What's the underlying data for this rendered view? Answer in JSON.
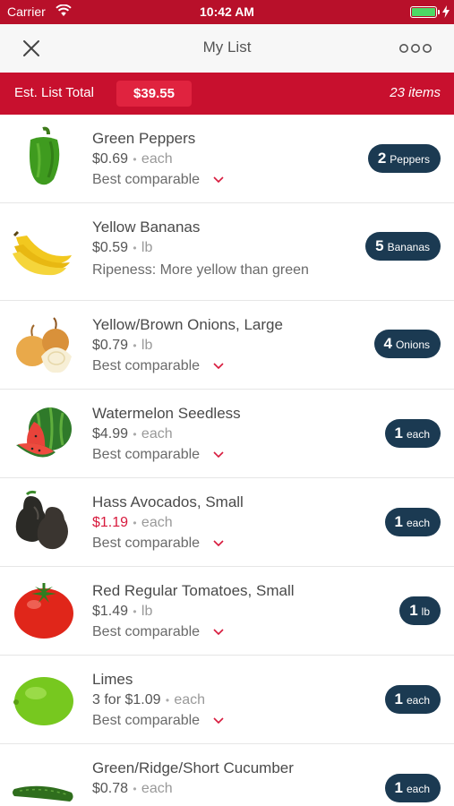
{
  "status_bar": {
    "carrier": "Carrier",
    "time": "10:42 AM",
    "battery_level": 1.0
  },
  "nav": {
    "title": "My List"
  },
  "summary": {
    "label": "Est. List Total",
    "total": "$39.55",
    "count": "23 items"
  },
  "items": [
    {
      "name": "Green Peppers",
      "price": "$0.69",
      "unit": "each",
      "sub": "Best comparable",
      "has_chevron": true,
      "qty": "2",
      "qty_unit": "Peppers",
      "sale": false
    },
    {
      "name": "Yellow Bananas",
      "price": "$0.59",
      "unit": "lb",
      "sub": "Ripeness: More yellow than green",
      "has_chevron": false,
      "qty": "5",
      "qty_unit": "Bananas",
      "sale": false
    },
    {
      "name": "Yellow/Brown Onions, Large",
      "price": "$0.79",
      "unit": "lb",
      "sub": "Best comparable",
      "has_chevron": true,
      "qty": "4",
      "qty_unit": "Onions",
      "sale": false
    },
    {
      "name": "Watermelon   Seedless",
      "price": "$4.99",
      "unit": "each",
      "sub": "Best comparable",
      "has_chevron": true,
      "qty": "1",
      "qty_unit": "each",
      "sale": false
    },
    {
      "name": "Hass Avocados, Small",
      "price": "$1.19",
      "unit": "each",
      "sub": "Best comparable",
      "has_chevron": true,
      "qty": "1",
      "qty_unit": "each",
      "sale": true
    },
    {
      "name": "Red Regular Tomatoes, Small",
      "price": "$1.49",
      "unit": "lb",
      "sub": "Best comparable",
      "has_chevron": true,
      "qty": "1",
      "qty_unit": "lb",
      "sale": false
    },
    {
      "name": "Limes",
      "price": "3 for $1.09",
      "unit": "each",
      "sub": "Best comparable",
      "has_chevron": true,
      "qty": "1",
      "qty_unit": "each",
      "sale": false
    },
    {
      "name": "Green/Ridge/Short Cucumber",
      "price": "$0.78",
      "unit": "each",
      "sub": "",
      "has_chevron": false,
      "qty": "1",
      "qty_unit": "each",
      "sale": false
    }
  ],
  "colors": {
    "brand_red": "#c8102e",
    "sale_red": "#d7193c",
    "qty_pill": "#1b3a52"
  },
  "icons": [
    "close-icon",
    "more-icon",
    "wifi-icon",
    "battery-icon",
    "chevron-down-icon"
  ]
}
